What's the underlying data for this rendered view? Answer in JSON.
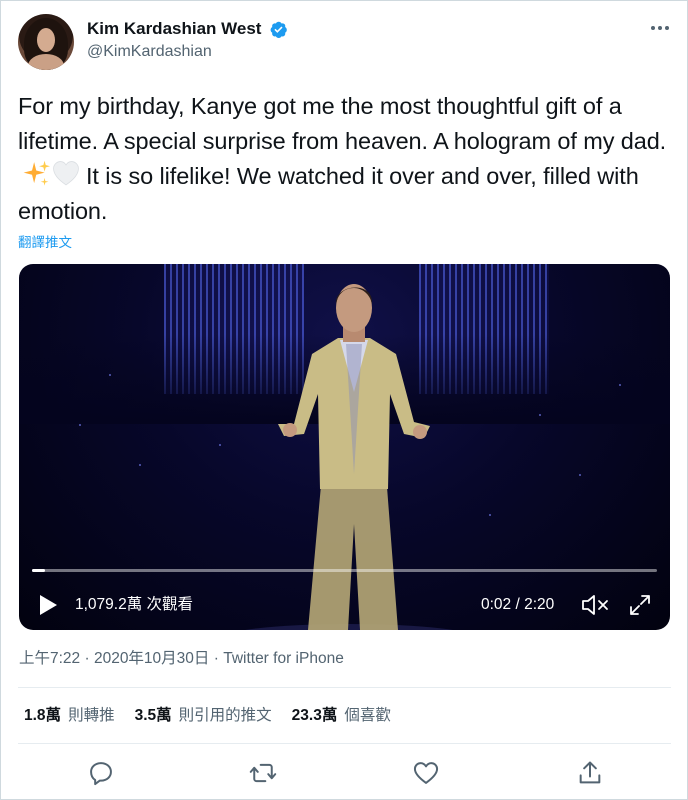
{
  "tweet": {
    "author_name": "Kim Kardashian West",
    "author_handle": "@KimKardashian",
    "text": "For my birthday, Kanye got me the most thoughtful gift of a lifetime. A special surprise from heaven. A hologram of my dad.",
    "text_after_emoji": "It is so lifelike! We watched it over and over, filled with emotion.",
    "emojis": [
      "sparkles-emoji",
      "white-heart-emoji"
    ],
    "translate_label": "翻譯推文"
  },
  "video": {
    "views_label": "1,079.2萬 次觀看",
    "timecode": "0:02 / 2:20",
    "progress": 0.02
  },
  "meta": {
    "time": "上午7:22",
    "separator": " · ",
    "date": "2020年10月30日",
    "source": "Twitter for iPhone"
  },
  "stats": {
    "retweets_value": "1.8萬",
    "retweets_label": "則轉推",
    "quotes_value": "3.5萬",
    "quotes_label": "則引用的推文",
    "likes_value": "23.3萬",
    "likes_label": "個喜歡"
  },
  "icons": [
    "verified-badge-icon",
    "more-icon",
    "play-icon",
    "mute-icon",
    "fullscreen-icon",
    "reply-icon",
    "retweet-icon",
    "like-icon",
    "share-icon"
  ],
  "colors": {
    "accent": "#1d9bf0",
    "secondary_text": "#536471",
    "text": "#0f1419"
  }
}
